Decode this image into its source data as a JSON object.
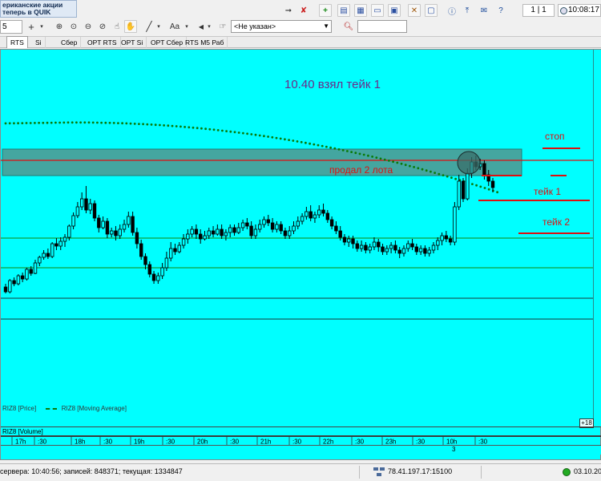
{
  "toolbar": {
    "promo_line1": "ериканские акции",
    "promo_line2": "теперь в QUIK",
    "interval_value": "5",
    "select_value": "<Не указан>",
    "page_counter": "1 | 1",
    "clock": "10:08:17",
    "font_btn_label": "Aa"
  },
  "tabs": [
    {
      "label": "RTS",
      "active": true
    },
    {
      "label": "Si",
      "active": false
    },
    {
      "label": "Сбер",
      "active": false
    },
    {
      "label": "OPT RTS",
      "active": false
    },
    {
      "label": "OPT Si",
      "active": false
    },
    {
      "label": "OPT Сбер",
      "active": false
    },
    {
      "label": "RTS M5 Раб",
      "active": false
    }
  ],
  "chart": {
    "legend_price": "RIZ8 [Price]",
    "legend_ma": "RIZ8 [Moving Average]",
    "volume_label": "RIZ8 [Volume]",
    "plus_box": "+18",
    "scroll_day": "3",
    "time_labels": [
      "17h",
      ":30",
      "18h",
      ":30",
      "19h",
      ":30",
      "20h",
      ":30",
      "21h",
      ":30",
      "22h",
      ":30",
      "23h",
      ":30",
      "10h",
      ":30"
    ],
    "annotations": {
      "title": "10.40 взял тейк 1",
      "sold": "продал 2 лота",
      "stop": "стоп",
      "take1": "тейк 1",
      "take2": "тейк 2"
    },
    "colors": {
      "background": "#00ffff",
      "zone": "#4c9d96",
      "candle": "#000000",
      "ma": "#0a7a0a",
      "red_line": "#dd1010",
      "text_purple": "#6b2a8a"
    },
    "candles": [
      [
        104,
        98,
        108,
        96
      ],
      [
        98,
        112,
        114,
        96
      ],
      [
        112,
        108,
        116,
        105
      ],
      [
        108,
        118,
        120,
        106
      ],
      [
        118,
        114,
        122,
        110
      ],
      [
        114,
        126,
        128,
        112
      ],
      [
        126,
        121,
        130,
        118
      ],
      [
        121,
        134,
        138,
        120
      ],
      [
        134,
        141,
        143,
        130
      ],
      [
        141,
        146,
        150,
        138
      ],
      [
        146,
        142,
        152,
        139
      ],
      [
        142,
        158,
        160,
        140
      ],
      [
        158,
        155,
        165,
        150
      ],
      [
        155,
        161,
        166,
        150
      ],
      [
        161,
        166,
        170,
        154
      ],
      [
        166,
        180,
        182,
        162
      ],
      [
        180,
        193,
        197,
        176
      ],
      [
        193,
        204,
        210,
        190
      ],
      [
        204,
        214,
        222,
        200
      ],
      [
        214,
        200,
        230,
        196
      ],
      [
        200,
        208,
        214,
        195
      ],
      [
        208,
        190,
        212,
        186
      ],
      [
        190,
        178,
        194,
        172
      ],
      [
        178,
        186,
        192,
        176
      ],
      [
        186,
        170,
        190,
        165
      ],
      [
        170,
        174,
        178,
        166
      ],
      [
        174,
        168,
        180,
        162
      ],
      [
        168,
        176,
        182,
        164
      ],
      [
        176,
        182,
        188,
        172
      ],
      [
        182,
        192,
        198,
        178
      ],
      [
        192,
        172,
        198,
        168
      ],
      [
        172,
        158,
        178,
        152
      ],
      [
        158,
        142,
        163,
        138
      ],
      [
        142,
        132,
        146,
        126
      ],
      [
        132,
        120,
        136,
        116
      ],
      [
        120,
        112,
        124,
        108
      ],
      [
        112,
        118,
        122,
        108
      ],
      [
        118,
        128,
        134,
        114
      ],
      [
        128,
        140,
        148,
        124
      ],
      [
        140,
        152,
        160,
        136
      ],
      [
        152,
        148,
        158,
        144
      ],
      [
        148,
        156,
        160,
        146
      ],
      [
        156,
        164,
        170,
        152
      ],
      [
        164,
        170,
        176,
        158
      ],
      [
        170,
        176,
        180,
        166
      ],
      [
        176,
        170,
        182,
        164
      ],
      [
        170,
        164,
        176,
        158
      ],
      [
        164,
        168,
        174,
        162
      ],
      [
        168,
        174,
        178,
        164
      ],
      [
        174,
        170,
        180,
        166
      ],
      [
        170,
        176,
        182,
        168
      ],
      [
        176,
        168,
        182,
        164
      ],
      [
        168,
        172,
        176,
        162
      ],
      [
        172,
        178,
        182,
        166
      ],
      [
        178,
        172,
        182,
        168
      ],
      [
        172,
        178,
        184,
        170
      ],
      [
        178,
        184,
        188,
        174
      ],
      [
        184,
        180,
        190,
        176
      ],
      [
        180,
        168,
        186,
        164
      ],
      [
        168,
        176,
        182,
        164
      ],
      [
        176,
        182,
        188,
        172
      ],
      [
        182,
        188,
        192,
        178
      ],
      [
        188,
        184,
        194,
        180
      ],
      [
        184,
        176,
        190,
        172
      ],
      [
        176,
        182,
        186,
        172
      ],
      [
        182,
        174,
        186,
        170
      ],
      [
        174,
        168,
        178,
        164
      ],
      [
        168,
        174,
        180,
        164
      ],
      [
        174,
        180,
        186,
        170
      ],
      [
        180,
        186,
        192,
        176
      ],
      [
        186,
        192,
        196,
        182
      ],
      [
        192,
        198,
        204,
        188
      ],
      [
        198,
        190,
        206,
        186
      ],
      [
        190,
        194,
        198,
        184
      ],
      [
        194,
        200,
        206,
        190
      ],
      [
        200,
        196,
        208,
        192
      ],
      [
        196,
        188,
        200,
        184
      ],
      [
        188,
        180,
        192,
        176
      ],
      [
        180,
        174,
        186,
        170
      ],
      [
        174,
        166,
        180,
        162
      ],
      [
        166,
        160,
        170,
        156
      ],
      [
        160,
        164,
        168,
        154
      ],
      [
        164,
        158,
        168,
        152
      ],
      [
        158,
        152,
        162,
        148
      ],
      [
        152,
        156,
        162,
        148
      ],
      [
        156,
        150,
        160,
        146
      ],
      [
        150,
        154,
        158,
        146
      ],
      [
        154,
        160,
        166,
        150
      ],
      [
        160,
        154,
        164,
        148
      ],
      [
        154,
        148,
        158,
        144
      ],
      [
        148,
        152,
        156,
        144
      ],
      [
        152,
        156,
        160,
        146
      ],
      [
        156,
        150,
        162,
        146
      ],
      [
        150,
        146,
        154,
        140
      ],
      [
        146,
        152,
        156,
        142
      ],
      [
        152,
        158,
        162,
        148
      ],
      [
        158,
        154,
        164,
        150
      ],
      [
        154,
        148,
        158,
        144
      ],
      [
        148,
        152,
        156,
        144
      ],
      [
        152,
        146,
        156,
        142
      ],
      [
        146,
        150,
        154,
        142
      ],
      [
        150,
        156,
        160,
        146
      ],
      [
        156,
        162,
        166,
        150
      ],
      [
        162,
        168,
        172,
        156
      ],
      [
        168,
        164,
        174,
        160
      ],
      [
        164,
        160,
        168,
        156
      ],
      [
        160,
        204,
        210,
        156
      ],
      [
        204,
        236,
        244,
        200
      ],
      [
        236,
        214,
        240,
        210
      ],
      [
        214,
        246,
        252,
        212
      ],
      [
        246,
        260,
        266,
        240
      ],
      [
        260,
        254,
        268,
        250
      ],
      [
        254,
        258,
        264,
        250
      ],
      [
        258,
        244,
        262,
        238
      ],
      [
        244,
        236,
        250,
        230
      ],
      [
        236,
        228,
        240,
        222
      ]
    ]
  }
}
